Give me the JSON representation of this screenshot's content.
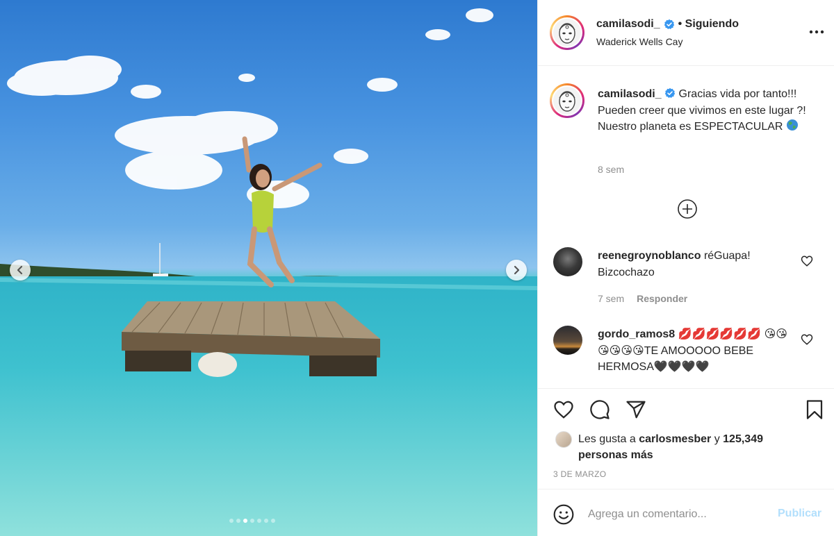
{
  "post": {
    "username": "camilasodi_",
    "follow_status": "• Siguiendo",
    "location": "Waderick Wells Cay",
    "caption_text": "Gracias vida por tanto!!! Pueden creer que vivimos en este lugar ?! Nuestro planeta es ESPECTACULAR",
    "caption_time": "8 sem",
    "date": "3 DE MARZO",
    "carousel": {
      "slide_count": 7,
      "active_index": 2
    }
  },
  "comments": [
    {
      "username": "reenegroynoblanco",
      "text": "réGuapa! Bizcochazo",
      "time": "7 sem",
      "reply_label": "Responder"
    },
    {
      "username": "gordo_ramos8",
      "lips": "💋💋💋💋💋💋",
      "kisses": "😘😘😘😘😘😘",
      "text": "TE AMOOOOO BEBE HERMOSA🖤🖤🖤🖤"
    }
  ],
  "likes": {
    "prefix": "Les gusta a",
    "user": "carlosmesber",
    "joiner": "y",
    "count_text": "125,349 personas más"
  },
  "add_comment": {
    "placeholder": "Agrega un comentario...",
    "publish_label": "Publicar"
  },
  "colors": {
    "verified": "#3897f0",
    "publish_disabled": "#b2dffc",
    "secondary_text": "#8e8e8e"
  }
}
